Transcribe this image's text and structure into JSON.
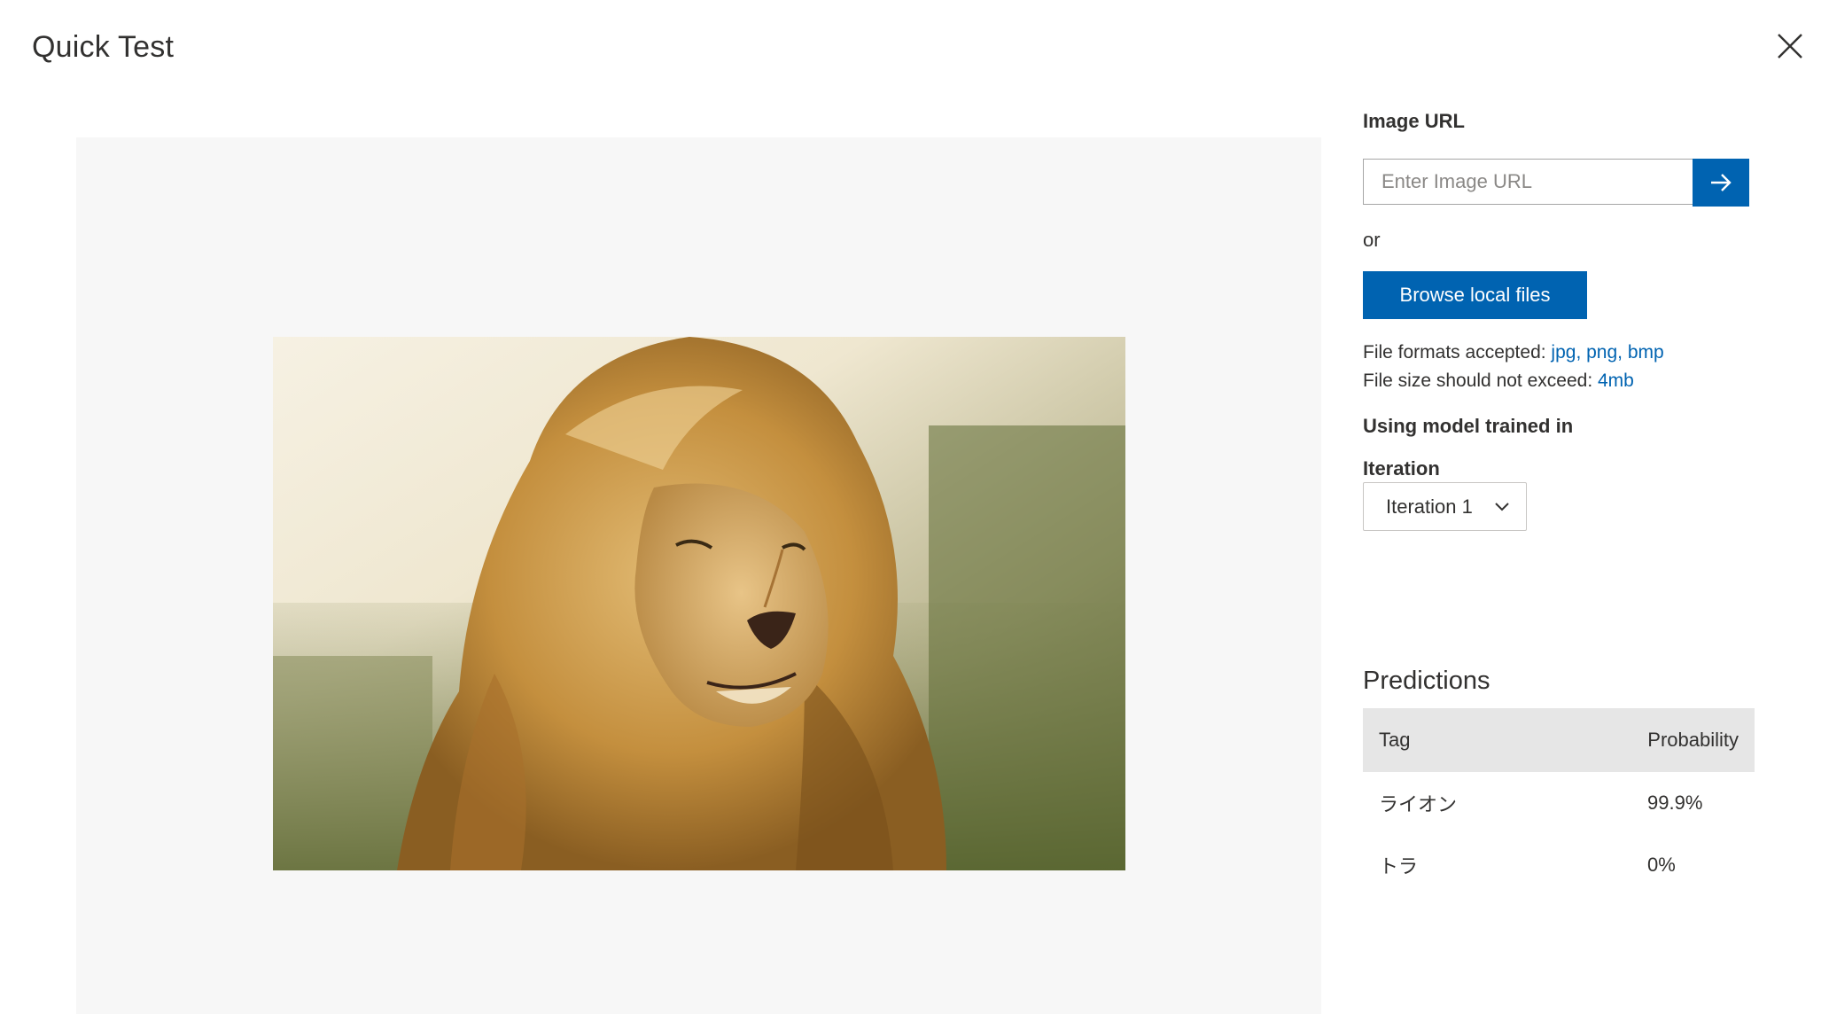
{
  "dialog": {
    "title": "Quick Test",
    "close_icon": "close-icon"
  },
  "image_url": {
    "label": "Image URL",
    "placeholder": "Enter Image URL",
    "submit_icon": "arrow-right-icon"
  },
  "or_text": "or",
  "browse_button": "Browse local files",
  "file_formats": {
    "prefix": "File formats accepted: ",
    "value": "jpg, png, bmp"
  },
  "file_size": {
    "prefix": "File size should not exceed: ",
    "value": "4mb"
  },
  "model": {
    "heading": "Using model trained in",
    "iteration_label": "Iteration",
    "selected_iteration": "Iteration 1",
    "dropdown_icon": "chevron-down-icon"
  },
  "predictions": {
    "title": "Predictions",
    "columns": [
      "Tag",
      "Probability"
    ],
    "rows": [
      {
        "tag": "ライオン",
        "probability": "99.9%"
      },
      {
        "tag": "トラ",
        "probability": "0%"
      }
    ]
  },
  "preview": {
    "image": "lion-photo"
  },
  "colors": {
    "accent": "#0063b1",
    "preview_background": "#f7f7f7",
    "table_header": "#e6e6e6"
  }
}
